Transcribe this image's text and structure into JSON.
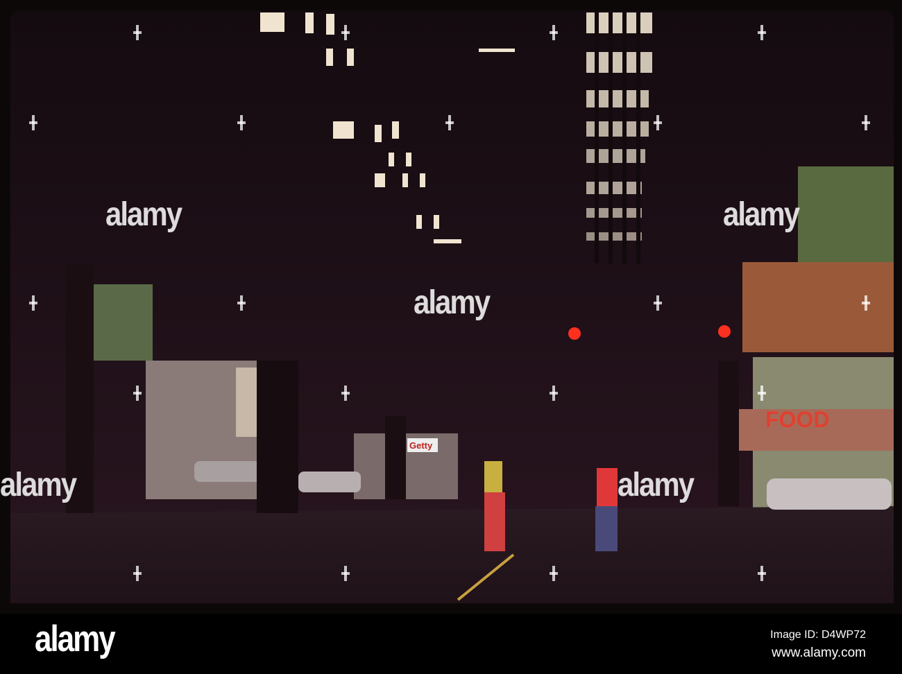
{
  "photo": {
    "signs": {
      "getty": "Getty",
      "food": "FOOD"
    },
    "watermark": "alamy"
  },
  "footer": {
    "logo": "alamy",
    "image_id": "Image ID: D4WP72",
    "website": "www.alamy.com"
  }
}
